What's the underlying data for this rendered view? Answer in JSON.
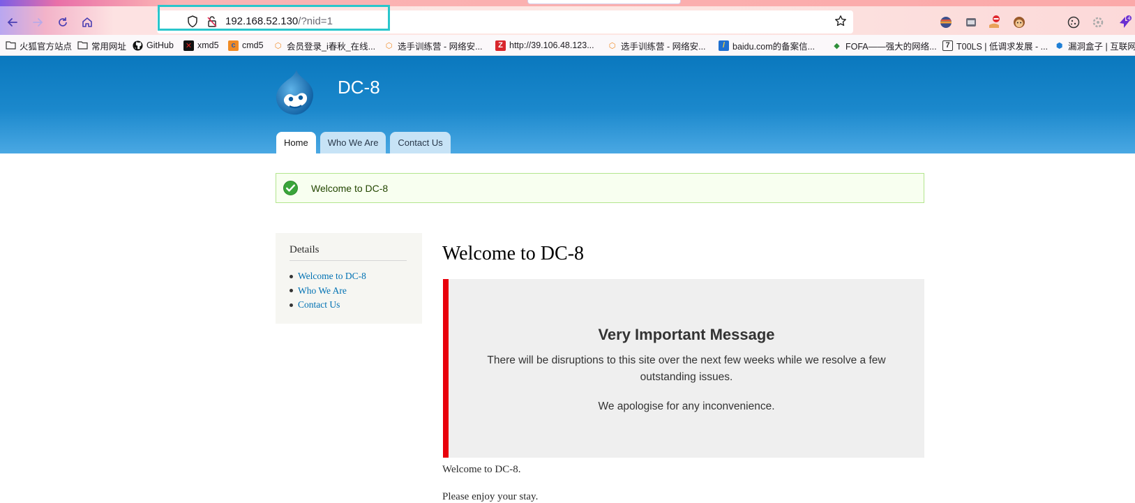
{
  "browser": {
    "url_host": "192.168.52.130",
    "url_path": "/?nid=1",
    "bookmarks": [
      {
        "label": "火狐官方站点"
      },
      {
        "label": "常用网址"
      },
      {
        "label": "GitHub"
      },
      {
        "label": "xmd5"
      },
      {
        "label": "cmd5"
      },
      {
        "label": "会员登录_i春秋_在线..."
      },
      {
        "label": "选手训练营 - 网络安..."
      },
      {
        "label": "http://39.106.48.123..."
      },
      {
        "label": "选手训练营 - 网络安..."
      },
      {
        "label": "baidu.com的备案信..."
      },
      {
        "label": "FOFA——强大的网络..."
      },
      {
        "label": "T00LS | 低调求发展 - ..."
      },
      {
        "label": "漏洞盒子 | 互联网..."
      }
    ]
  },
  "site": {
    "name": "DC-8",
    "nav": [
      {
        "label": "Home"
      },
      {
        "label": "Who We Are"
      },
      {
        "label": "Contact Us"
      }
    ]
  },
  "status_message": "Welcome to DC-8",
  "sidebar": {
    "title": "Details",
    "links": [
      {
        "label": "Welcome to DC-8"
      },
      {
        "label": "Who We Are"
      },
      {
        "label": "Contact Us"
      }
    ]
  },
  "content": {
    "title": "Welcome to DC-8",
    "notice_heading": "Very Important Message",
    "notice_text": "There will be disruptions to this site over the next few weeks while we resolve a few outstanding issues.",
    "notice_apology": "We apologise for any inconvenience.",
    "body_line1": "Welcome to DC-8.",
    "body_line2": "Please enjoy your stay."
  },
  "colors": {
    "header_blue": "#0a78be",
    "notice_red": "#e8000b",
    "link_blue": "#0071b3",
    "url_highlight": "#2ac6cc"
  }
}
